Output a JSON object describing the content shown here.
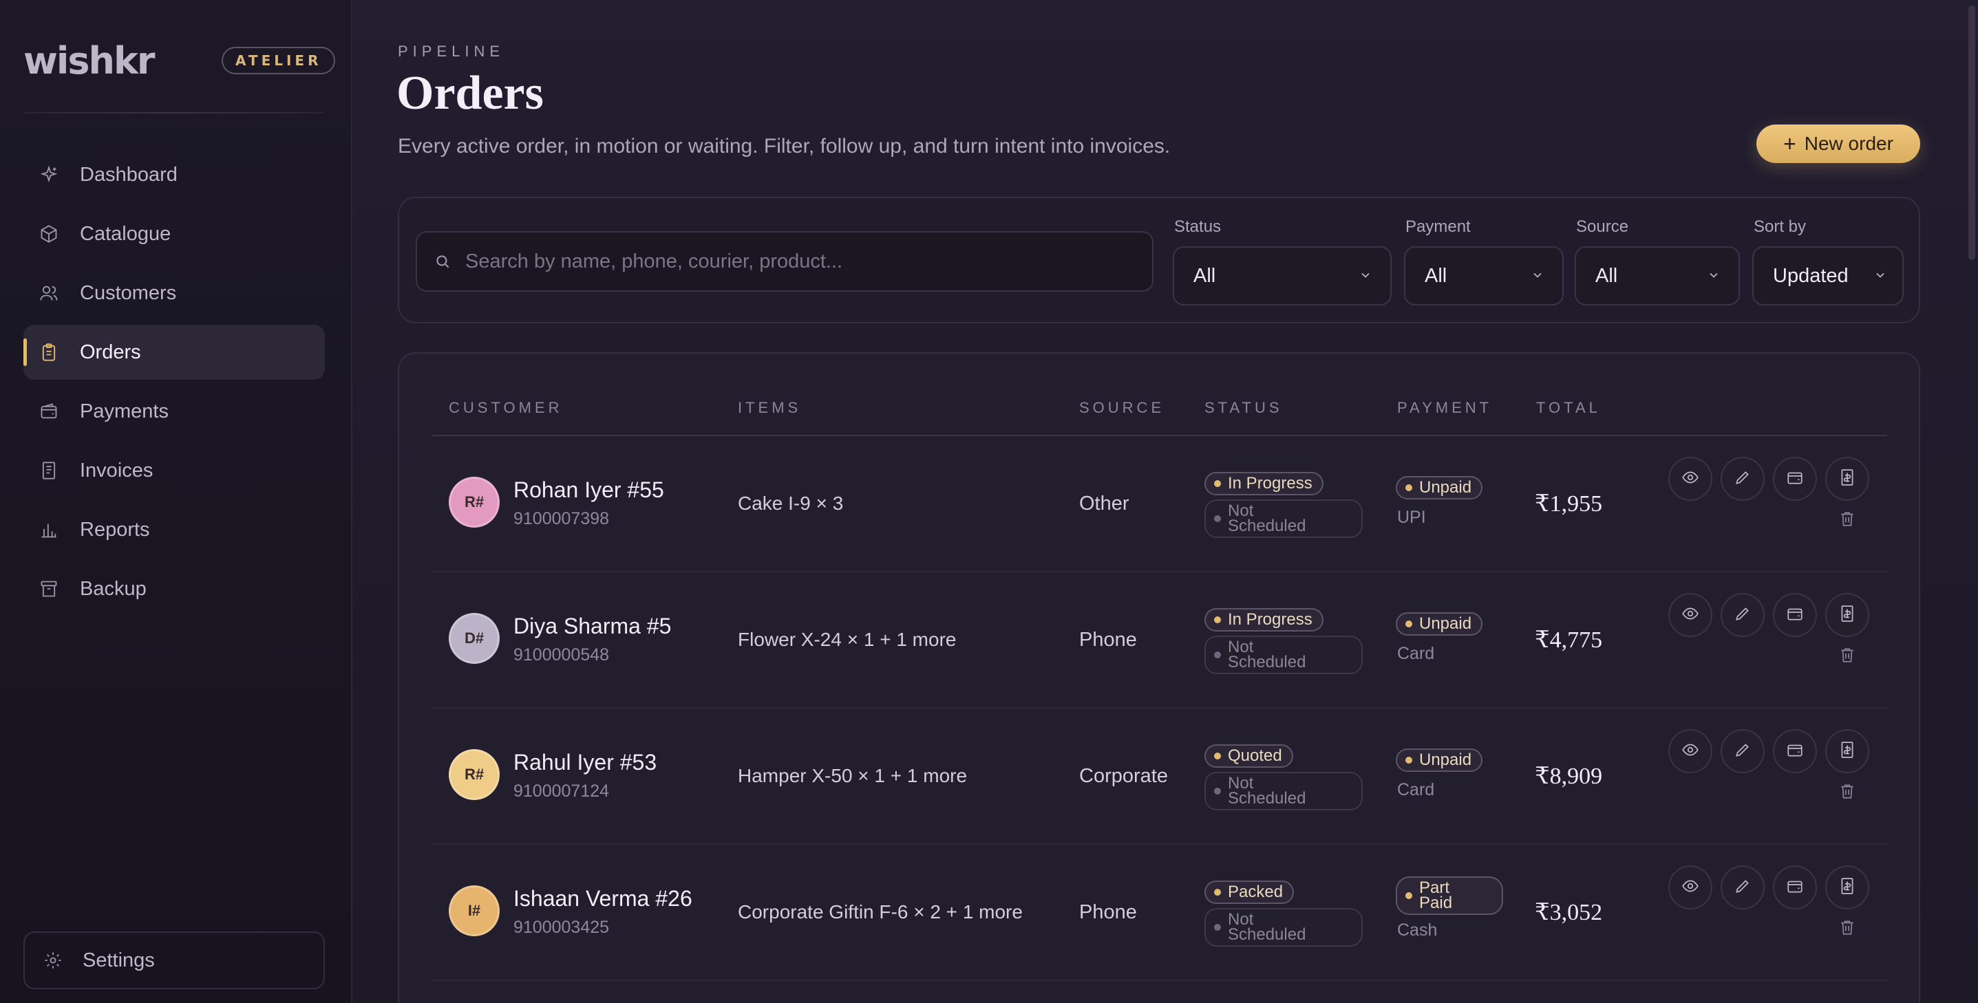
{
  "brand": {
    "name": "wishkr",
    "badge": "ATELIER"
  },
  "nav": {
    "items": [
      {
        "label": "Dashboard",
        "icon": "sparkle-icon"
      },
      {
        "label": "Catalogue",
        "icon": "box-icon"
      },
      {
        "label": "Customers",
        "icon": "users-icon"
      },
      {
        "label": "Orders",
        "icon": "clipboard-icon",
        "active": true
      },
      {
        "label": "Payments",
        "icon": "wallet-icon"
      },
      {
        "label": "Invoices",
        "icon": "receipt-icon"
      },
      {
        "label": "Reports",
        "icon": "bar-chart-icon"
      },
      {
        "label": "Backup",
        "icon": "archive-icon"
      }
    ],
    "settings": "Settings"
  },
  "header": {
    "eyebrow": "PIPELINE",
    "title": "Orders",
    "subtitle": "Every active order, in motion or waiting. Filter, follow up, and turn intent into invoices.",
    "new_order": "New order"
  },
  "filters": {
    "search_placeholder": "Search by name, phone, courier, product...",
    "status": {
      "label": "Status",
      "value": "All"
    },
    "payment": {
      "label": "Payment",
      "value": "All"
    },
    "source": {
      "label": "Source",
      "value": "All"
    },
    "sort": {
      "label": "Sort by",
      "value": "Updated"
    }
  },
  "table": {
    "columns": {
      "customer": "CUSTOMER",
      "items": "ITEMS",
      "source": "SOURCE",
      "status": "STATUS",
      "payment": "PAYMENT",
      "total": "TOTAL"
    },
    "rows": [
      {
        "initials": "R#",
        "avatar_color": "#e39ac0",
        "name": "Rohan Iyer #55",
        "phone": "9100007398",
        "items": "Cake I-9 × 3",
        "source": "Other",
        "status": "In Progress",
        "schedule_l1": "Not",
        "schedule_l2": "Scheduled",
        "payment": "Unpaid",
        "payment_two_line": false,
        "method": "UPI",
        "total": "₹1,955"
      },
      {
        "initials": "D#",
        "avatar_color": "#bcb3c9",
        "name": "Diya Sharma #5",
        "phone": "9100000548",
        "items": "Flower X-24 × 1 + 1 more",
        "source": "Phone",
        "status": "In Progress",
        "schedule_l1": "Not",
        "schedule_l2": "Scheduled",
        "payment": "Unpaid",
        "payment_two_line": false,
        "method": "Card",
        "total": "₹4,775"
      },
      {
        "initials": "R#",
        "avatar_color": "#efcc87",
        "name": "Rahul Iyer #53",
        "phone": "9100007124",
        "items": "Hamper X-50 × 1 + 1 more",
        "source": "Corporate",
        "status": "Quoted",
        "schedule_l1": "Not",
        "schedule_l2": "Scheduled",
        "payment": "Unpaid",
        "payment_two_line": false,
        "method": "Card",
        "total": "₹8,909"
      },
      {
        "initials": "I#",
        "avatar_color": "#e6b46c",
        "name": "Ishaan Verma #26",
        "phone": "9100003425",
        "items": "Corporate Giftin F-6 × 2 + 1 more",
        "source": "Phone",
        "status": "Packed",
        "schedule_l1": "Not",
        "schedule_l2": "Scheduled",
        "payment_l1": "Part",
        "payment_l2": "Paid",
        "payment_two_line": true,
        "method": "Cash",
        "total": "₹3,052"
      }
    ],
    "row_actions": [
      "eye-icon",
      "pencil-icon",
      "wallet-icon",
      "invoice-icon",
      "trash-icon"
    ]
  },
  "colors": {
    "accent": "#e2bb72",
    "background": "#1f1b2a",
    "surface": "#221e2e"
  }
}
